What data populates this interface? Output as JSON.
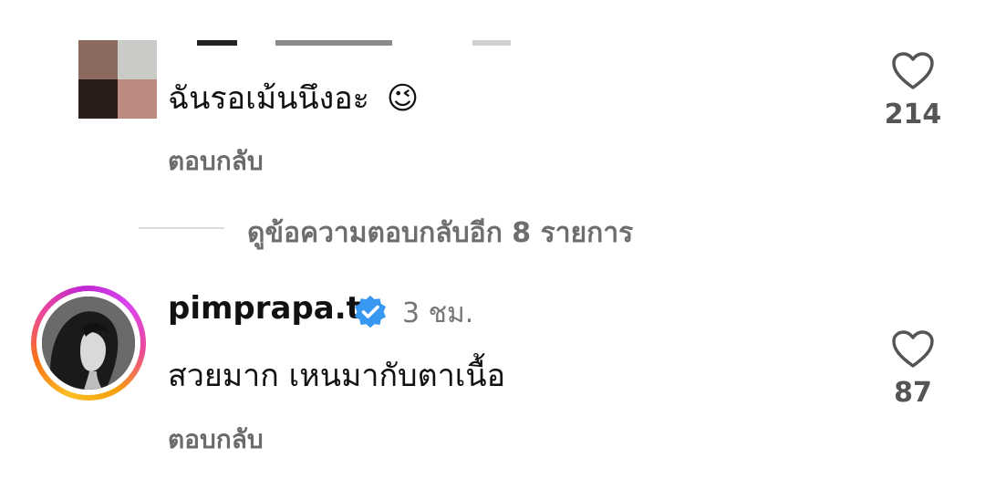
{
  "comments": [
    {
      "text": "ฉันรอเม้นนึงอะ",
      "emoji": "😉",
      "reply_label": "ตอบกลับ",
      "likes": "214",
      "avatar": "pixelated-avatar"
    },
    {
      "username": "pimprapa.t",
      "verified_icon": "verified-badge-icon",
      "time": "3 ชม.",
      "text": "สวยมาก เหนมากับตาเนื้อ",
      "reply_label": "ตอบกลับ",
      "likes": "87",
      "avatar": "story-ring-avatar"
    }
  ],
  "view_more_replies": "ดูข้อความตอบกลับอีก 8 รายการ",
  "colors": {
    "secondary_text": "#6b6b6b",
    "verified_blue": "#3897f0",
    "divider": "#dcdcdc"
  }
}
